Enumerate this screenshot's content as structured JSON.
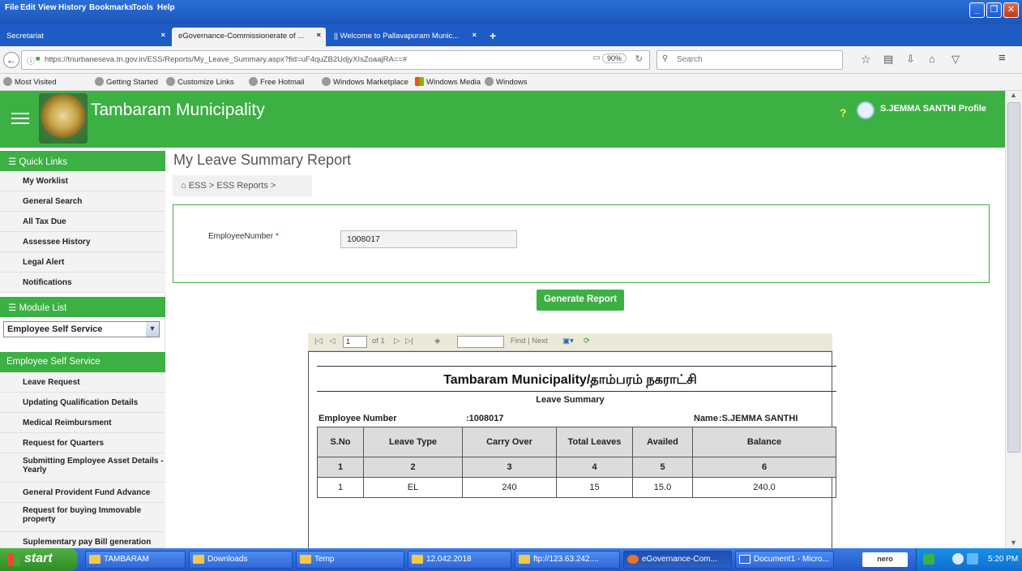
{
  "browser": {
    "menu": [
      "File",
      "Edit",
      "View",
      "History",
      "Bookmarks",
      "Tools",
      "Help"
    ],
    "tabs": [
      {
        "label": "Secretariat",
        "close": "×"
      },
      {
        "label": "eGovernance-Commissionerate of ...",
        "close": "×"
      },
      {
        "label": "|| Welcome to Pallavapuram Munic...",
        "close": "×"
      }
    ],
    "new_tab": "+",
    "url": "https://tnurbaneseva.tn.gov.in/ESS/Reports/My_Leave_Summary.aspx?fid=uF4quZB2UdjyXIsZoaajRA==#",
    "zoom": "90%",
    "search_placeholder": "Search",
    "bookmarks": [
      "Most Visited",
      "Getting Started",
      "Customize Links",
      "Free Hotmail",
      "Windows Marketplace",
      "Windows Media",
      "Windows"
    ]
  },
  "header": {
    "title": "Tambaram Municipality",
    "help": "?",
    "user": "S.JEMMA SANTHI",
    "profile": "Profile"
  },
  "sidebar": {
    "quick_links_title": "Quick Links",
    "quick_links": [
      "My Worklist",
      "General Search",
      "All Tax Due",
      "Assessee History",
      "Legal Alert",
      "Notifications"
    ],
    "module_title": "Module List",
    "module_selected": "Employee Self Service",
    "section_title": "Employee Self Service",
    "items": [
      "Leave Request",
      "Updating Qualification Details",
      "Medical Reimbursment",
      "Request for Quarters",
      "Submitting Employee Asset Details - Yearly",
      "General Provident Fund Advance",
      "Request for buying Immovable property",
      "Suplementary pay Bill generation"
    ]
  },
  "main": {
    "page_title": "My Leave Summary Report",
    "breadcrumb": "ESS > ESS Reports >",
    "employee_label": "EmployeeNumber",
    "required_mark": "*",
    "employee_value": "1008017",
    "generate_label": "Generate Report"
  },
  "report_toolbar": {
    "page": "1",
    "of": "of 1",
    "find_next": "Find | Next"
  },
  "report": {
    "title": "Tambaram Municipality/தாம்பரம் நகராட்சி",
    "subtitle": "Leave Summary",
    "emp_label": "Employee Number",
    "emp_value": ":1008017",
    "name_label": "Name",
    "name_value": ":S.JEMMA SANTHI",
    "columns": [
      "S.No",
      "Leave Type",
      "Carry Over",
      "Total Leaves",
      "Availed",
      "Balance"
    ],
    "col_numbers": [
      "1",
      "2",
      "3",
      "4",
      "5",
      "6"
    ],
    "rows": [
      [
        "1",
        "EL",
        "240",
        "15",
        "15.0",
        "240.0"
      ]
    ]
  },
  "taskbar": {
    "start": "start",
    "items": [
      "TAMBARAM",
      "Downloads",
      "Temp",
      "12.042.2018",
      "ftp://123.63.242....",
      "eGovernance-Com...",
      "Document1 - Micro..."
    ],
    "time": "5:20 PM"
  }
}
